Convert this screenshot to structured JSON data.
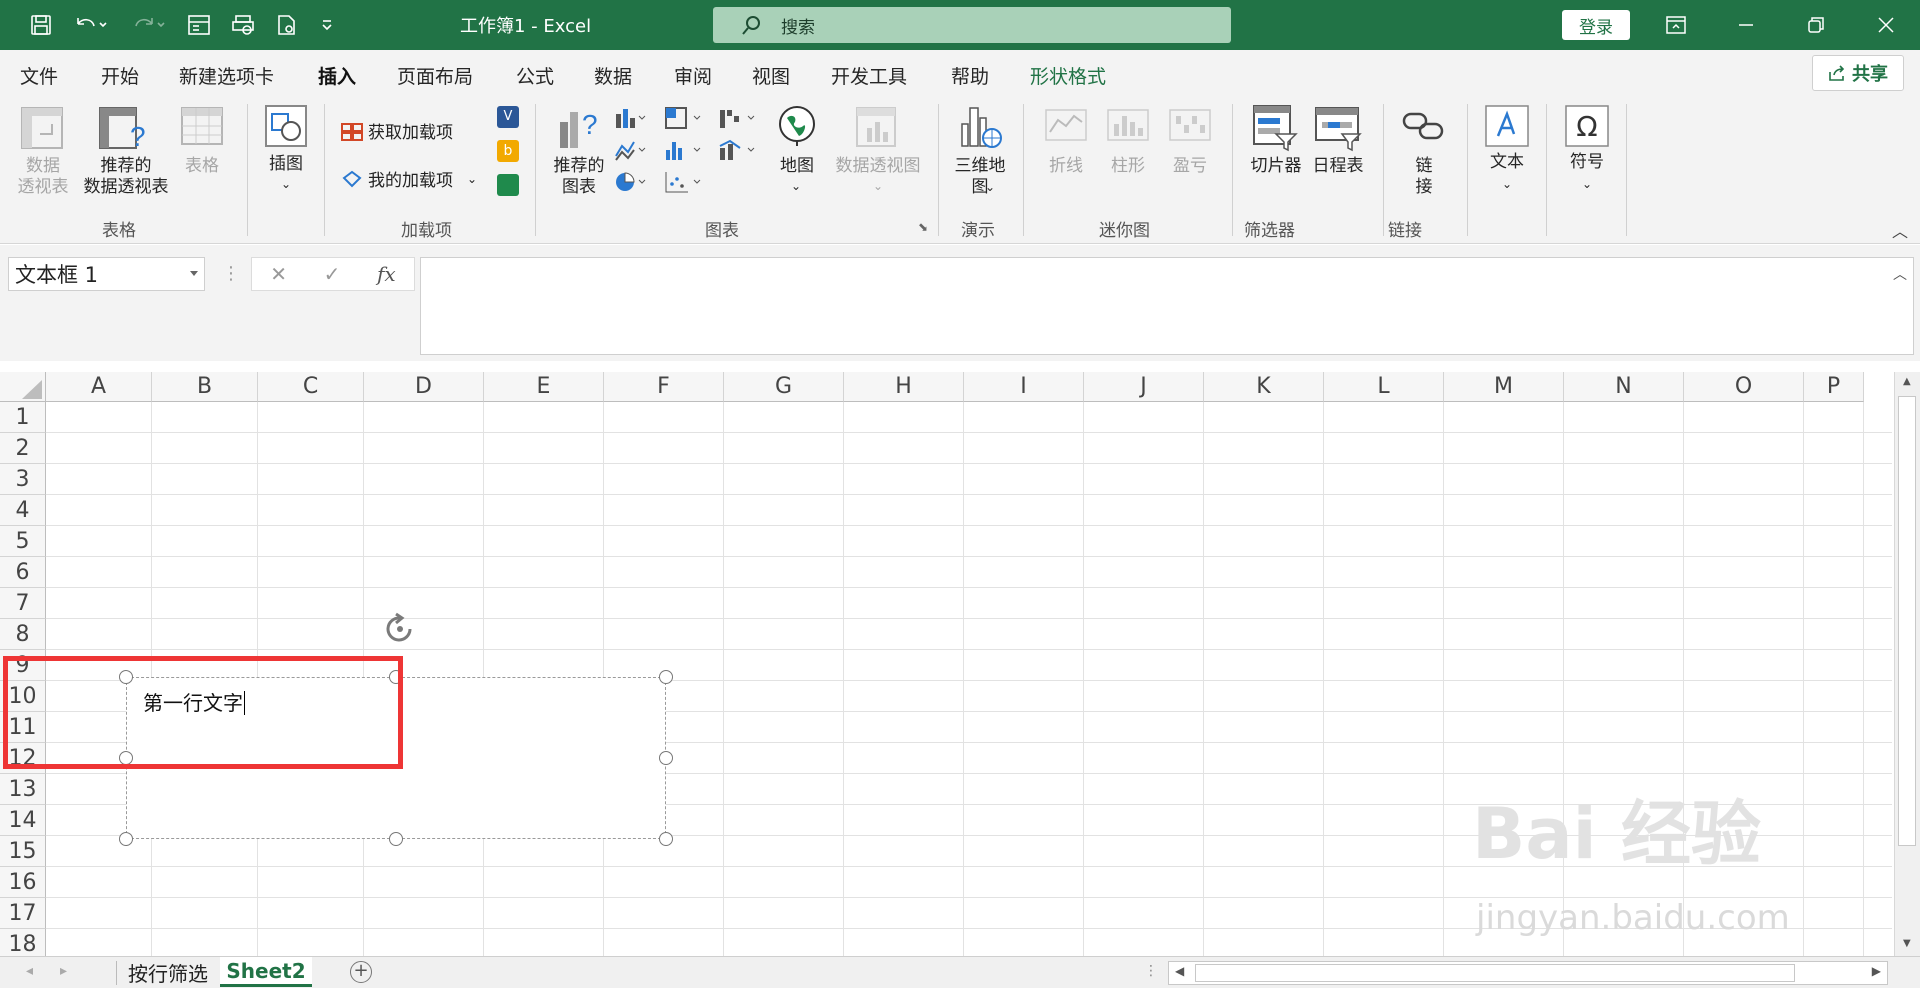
{
  "titlebar": {
    "doc_title": "工作簿1  -  Excel",
    "search_placeholder": "搜索",
    "login_label": "登录"
  },
  "menu": {
    "tabs": [
      {
        "label": "文件"
      },
      {
        "label": "开始"
      },
      {
        "label": "新建选项卡"
      },
      {
        "label": "插入"
      },
      {
        "label": "页面布局"
      },
      {
        "label": "公式"
      },
      {
        "label": "数据"
      },
      {
        "label": "审阅"
      },
      {
        "label": "视图"
      },
      {
        "label": "开发工具"
      },
      {
        "label": "帮助"
      },
      {
        "label": "形状格式"
      }
    ],
    "share_label": "共享"
  },
  "ribbon": {
    "pivot_table": "数据\n透视表",
    "rec_pivot": "推荐的\n数据透视表",
    "table": "表格",
    "group_table": "表格",
    "illustrations": "插图",
    "get_addins": "获取加载项",
    "my_addins": "我的加载项",
    "group_addins": "加载项",
    "rec_charts": "推荐的\n图表",
    "map": "地图",
    "pivot_chart": "数据透视图",
    "group_charts": "图表",
    "map3d": "三维地\n图",
    "group_tour": "演示",
    "line": "折线",
    "column": "柱形",
    "winloss": "盈亏",
    "group_spark": "迷你图",
    "slicer": "切片器",
    "timeline": "日程表",
    "group_filter": "筛选器",
    "link": "链\n接",
    "group_links": "链接",
    "text": "文本",
    "symbol": "符号"
  },
  "formula_bar": {
    "name_box": "文本框 1",
    "fx": "fx"
  },
  "grid": {
    "columns": [
      "A",
      "B",
      "C",
      "D",
      "E",
      "F",
      "G",
      "H",
      "I",
      "J",
      "K",
      "L",
      "M",
      "N",
      "O",
      "P"
    ],
    "rows": [
      "1",
      "2",
      "3",
      "4",
      "5",
      "6",
      "7",
      "8",
      "9",
      "10",
      "11",
      "12",
      "13",
      "14",
      "15",
      "16",
      "17",
      "18"
    ]
  },
  "textbox": {
    "text": "第一行文字"
  },
  "sheets": {
    "tabs": [
      {
        "label": "按行筛选"
      },
      {
        "label": "Sheet2"
      }
    ]
  },
  "watermark": {
    "brand": "Bai 经验",
    "url": "jingyan.baidu.com"
  },
  "colors": {
    "brand_green": "#217346",
    "highlight_red": "#ee3535"
  }
}
